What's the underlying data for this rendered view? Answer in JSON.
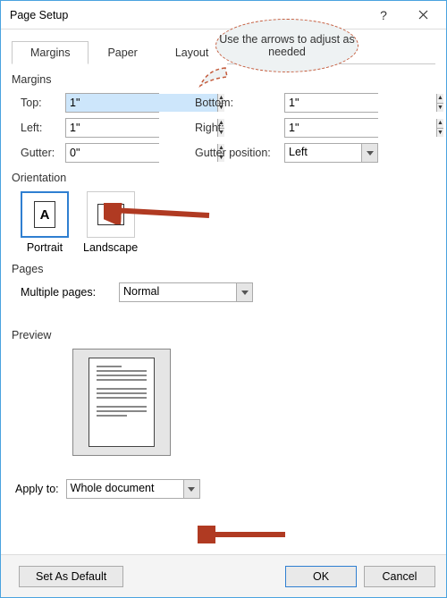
{
  "window": {
    "title": "Page Setup"
  },
  "tabs": {
    "margins": "Margins",
    "paper": "Paper",
    "layout": "Layout"
  },
  "margins": {
    "section": "Margins",
    "top_label": "Top:",
    "top_value": "1\"",
    "bottom_label": "Bottom:",
    "bottom_value": "1\"",
    "left_label": "Left:",
    "left_value": "1\"",
    "right_label": "Right:",
    "right_value": "1\"",
    "gutter_label": "Gutter:",
    "gutter_value": "0\"",
    "gutterpos_label": "Gutter position:",
    "gutterpos_value": "Left"
  },
  "orientation": {
    "section": "Orientation",
    "portrait": "Portrait",
    "landscape": "Landscape"
  },
  "pages": {
    "section": "Pages",
    "multiple_label": "Multiple pages:",
    "multiple_value": "Normal"
  },
  "preview": {
    "section": "Preview"
  },
  "applyto": {
    "label": "Apply to:",
    "value": "Whole document"
  },
  "buttons": {
    "default": "Set As Default",
    "ok": "OK",
    "cancel": "Cancel"
  },
  "callout": {
    "text": "Use the arrows to adjust as needed"
  }
}
